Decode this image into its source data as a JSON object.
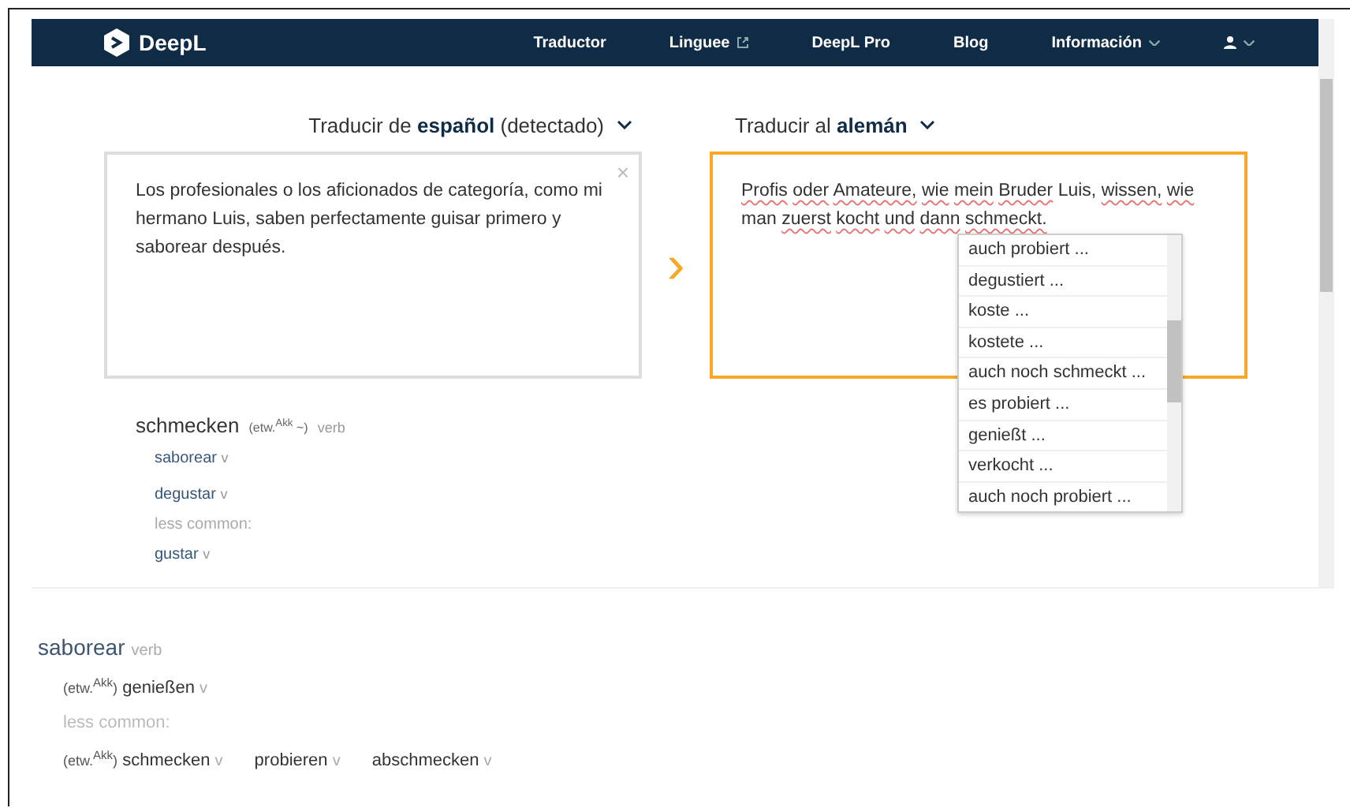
{
  "nav": {
    "brand": "DeepL",
    "items": [
      {
        "label": "Traductor",
        "kind": "plain"
      },
      {
        "label": "Linguee",
        "kind": "external"
      },
      {
        "label": "DeepL Pro",
        "kind": "plain"
      },
      {
        "label": "Blog",
        "kind": "plain"
      },
      {
        "label": "Información",
        "kind": "menu"
      }
    ]
  },
  "source": {
    "prefix": "Traducir de ",
    "language": "español",
    "suffix": " (detectado)",
    "text": "Los profesionales o los aficionados de categoría, como mi hermano Luis, saben perfectamente guisar primero y saborear después.",
    "clear": "×"
  },
  "arrow": "›",
  "target": {
    "prefix": "Traducir al ",
    "language": "alemán",
    "words": [
      {
        "text": "Profis",
        "flagged": true
      },
      {
        "text": "oder",
        "flagged": true
      },
      {
        "text": "Amateure,",
        "flagged": true
      },
      {
        "text": "wie",
        "flagged": true
      },
      {
        "text": "mein",
        "flagged": true
      },
      {
        "text": "Bruder",
        "flagged": true
      },
      {
        "text": "Luis,",
        "flagged": false
      },
      {
        "text": "wissen,",
        "flagged": true
      },
      {
        "text": "wie",
        "flagged": true
      },
      {
        "text": "man",
        "flagged": false
      },
      {
        "text": "zuerst",
        "flagged": true
      },
      {
        "text": "kocht",
        "flagged": true
      },
      {
        "text": "und",
        "flagged": true
      },
      {
        "text": "dann",
        "flagged": true
      },
      {
        "text": "schmeckt.",
        "flagged": true
      }
    ],
    "alternatives": [
      "auch probiert ...",
      "degustiert ...",
      "koste ...",
      "kostete ...",
      "auch noch schmeckt ...",
      "es probiert ...",
      "genießt ...",
      "verkocht ...",
      "auch noch probiert ..."
    ]
  },
  "dictionary": {
    "headword": "schmecken",
    "grammar": "(etw.$^{Akk}$ ~)",
    "pos": "verb",
    "entries": [
      {
        "text": "saborear",
        "pos": "v",
        "kind": "entry"
      },
      {
        "text": "degustar",
        "pos": "v",
        "kind": "entry"
      },
      {
        "text": "less common:",
        "kind": "note"
      },
      {
        "text": "gustar",
        "pos": "v",
        "kind": "entry"
      }
    ]
  },
  "lookup": {
    "headword": "saborear",
    "pos": "verb",
    "lines": [
      {
        "kind": "entries",
        "items": [
          {
            "grammar": "(etw.$^{Akk}$)",
            "text": "genießen",
            "pos": "v"
          }
        ]
      },
      {
        "kind": "note",
        "text": "less common:"
      },
      {
        "kind": "entries",
        "items": [
          {
            "grammar": "(etw.$^{Akk}$)",
            "text": "schmecken",
            "pos": "v"
          },
          {
            "text": "probieren",
            "pos": "v"
          },
          {
            "text": "abschmecken",
            "pos": "v"
          }
        ]
      }
    ]
  }
}
